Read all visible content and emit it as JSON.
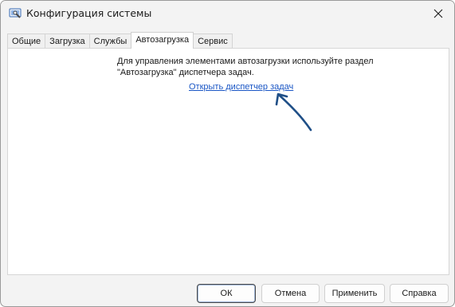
{
  "window": {
    "title": "Конфигурация системы",
    "app_icon": "msconfig-icon",
    "close_icon": "close-icon"
  },
  "tabs": [
    {
      "label": "Общие",
      "active": false
    },
    {
      "label": "Загрузка",
      "active": false
    },
    {
      "label": "Службы",
      "active": false
    },
    {
      "label": "Автозагрузка",
      "active": true
    },
    {
      "label": "Сервис",
      "active": false
    }
  ],
  "panel": {
    "info_line1": "Для управления элементами автозагрузки используйте раздел",
    "info_line2": "\"Автозагрузка\" диспетчера задач.",
    "link_text": "Открыть диспетчер задач",
    "annotation_icon": "arrow-pointer-icon"
  },
  "buttons": {
    "ok": "ОК",
    "cancel": "Отмена",
    "apply": "Применить",
    "help": "Справка"
  },
  "colors": {
    "link": "#1a56c5",
    "annotation_arrow": "#1f4f87"
  }
}
